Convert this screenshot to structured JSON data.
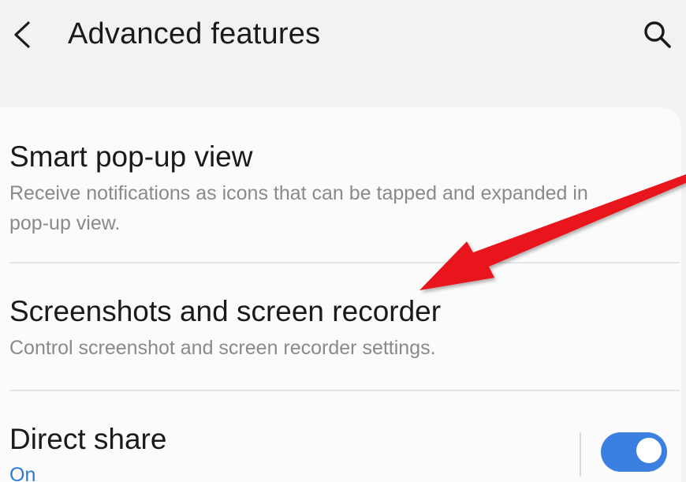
{
  "header": {
    "back_icon": "chevron-left-icon",
    "title": "Advanced features",
    "search_icon": "search-icon"
  },
  "items": [
    {
      "title": "Smart pop-up view",
      "subtitle": "Receive notifications as icons that can be tapped and expanded in pop-up view."
    },
    {
      "title": "Screenshots and screen recorder",
      "subtitle": "Control screenshot and screen recorder settings."
    },
    {
      "title": "Direct share",
      "status": "On",
      "toggle_on": true
    }
  ],
  "colors": {
    "accent": "#3b7fe0",
    "status_text": "#2a7ad6",
    "annotation_arrow": "#e8151b"
  }
}
